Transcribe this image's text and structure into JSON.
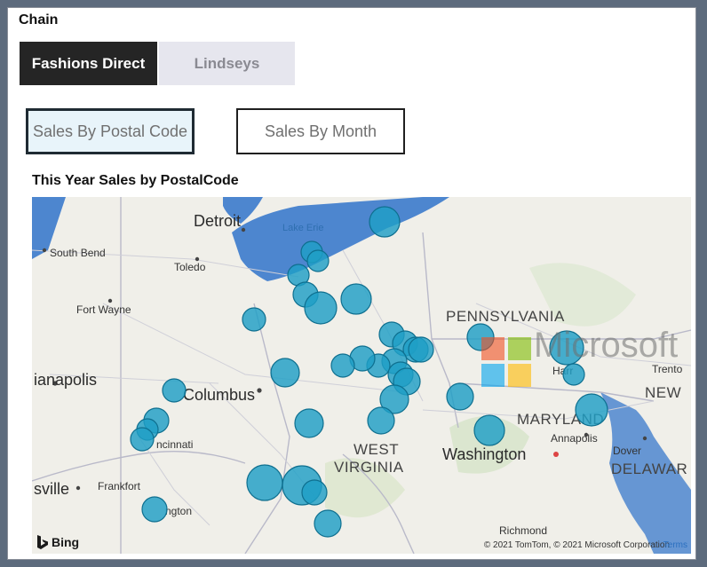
{
  "slicer": {
    "title": "Chain",
    "options": [
      "Fashions Direct",
      "Lindseys"
    ]
  },
  "buttons": {
    "postal": "Sales By Postal Code",
    "month": "Sales By Month"
  },
  "map": {
    "title": "This Year Sales by PostalCode",
    "attribution": "© 2021 TomTom, © 2021 Microsoft Corporation",
    "terms": "Terms",
    "bing_label": "Bing",
    "watermark_brand": "Microsoft",
    "labels": {
      "detroit": "Detroit",
      "lake_erie": "Lake Erie",
      "south_bend": "South Bend",
      "toledo": "Toledo",
      "fort_wayne": "Fort Wayne",
      "indianapolis": "ianapolis",
      "columbus": "Columbus",
      "cincinnati": "ncinnati",
      "louisville": "sville",
      "frankfort": "Frankfort",
      "lexington": "ngton",
      "pennsylvania": "PENNSYLVANIA",
      "west": "WEST",
      "virginia": "VIRGINIA",
      "washington": "Washington",
      "maryland": "MARYLAND",
      "annapolis": "Annapolis",
      "dover": "Dover",
      "delaware": "DELAWAR",
      "new_jersey": "NEW",
      "trenton": "Trento",
      "richmond": "Richmond",
      "harrisburg": "Harr"
    },
    "colors": {
      "bubble_fill": "#1e9fc6",
      "bubble_stroke": "#0e6f8f",
      "water": "#4d86cf"
    }
  }
}
